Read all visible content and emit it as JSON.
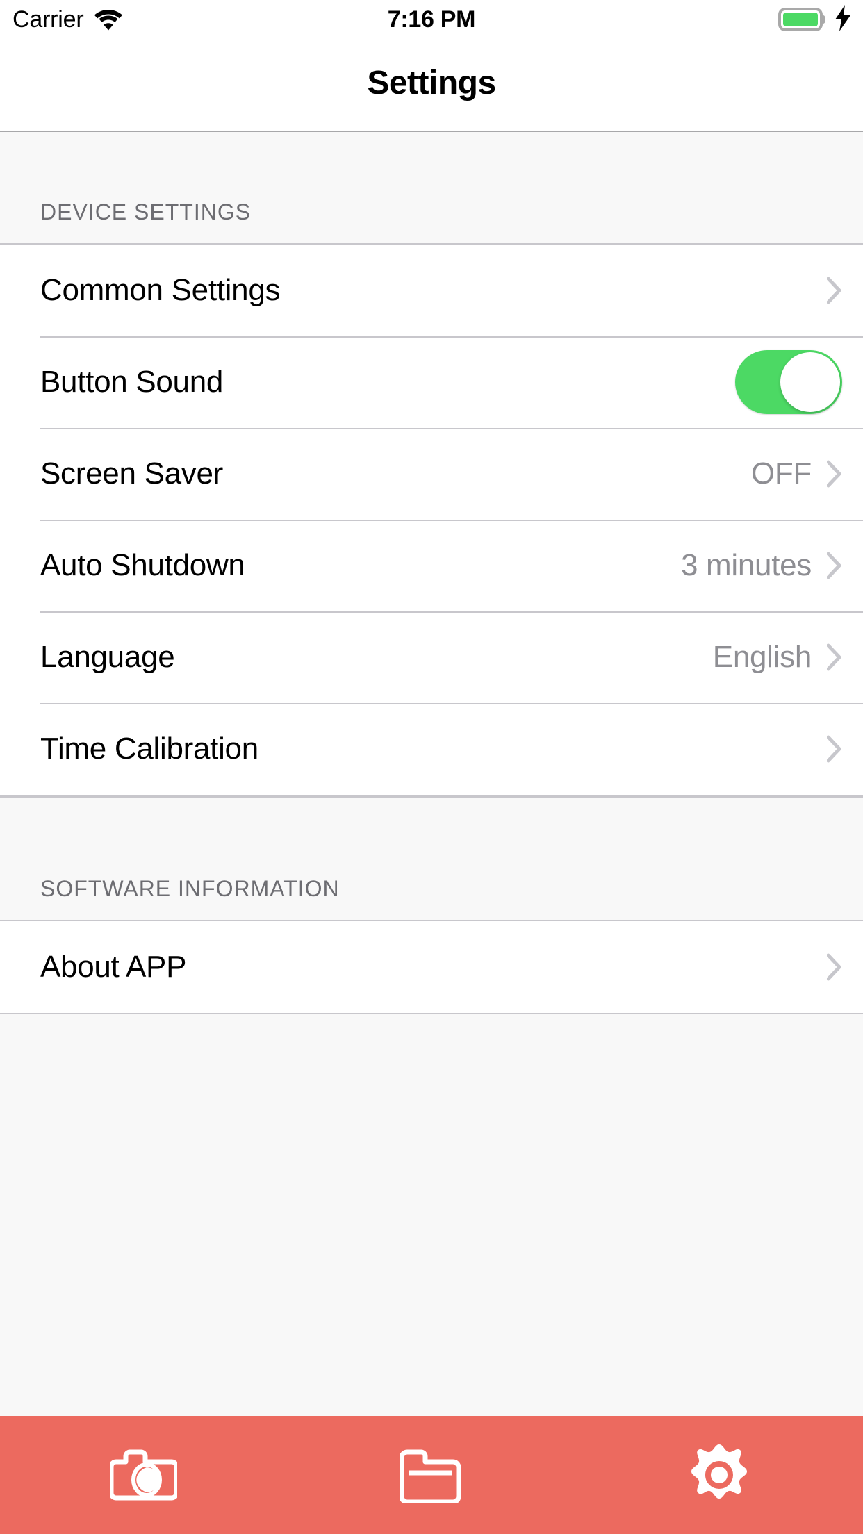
{
  "status_bar": {
    "carrier": "Carrier",
    "time": "7:16 PM",
    "wifi_icon": "wifi-icon",
    "battery_icon": "battery-full-icon",
    "charging_icon": "lightning-bolt-icon",
    "battery_color": "#4cd964"
  },
  "nav_bar": {
    "title": "Settings"
  },
  "sections": [
    {
      "header": "DEVICE SETTINGS",
      "rows": [
        {
          "label": "Common Settings",
          "value": "",
          "accessory": "chevron"
        },
        {
          "label": "Button Sound",
          "value": "",
          "accessory": "switch",
          "switch_on": true
        },
        {
          "label": "Screen Saver",
          "value": "OFF",
          "accessory": "chevron"
        },
        {
          "label": "Auto Shutdown",
          "value": "3 minutes",
          "accessory": "chevron"
        },
        {
          "label": "Language",
          "value": "English",
          "accessory": "chevron"
        },
        {
          "label": "Time Calibration",
          "value": "",
          "accessory": "chevron"
        }
      ]
    },
    {
      "header": "SOFTWARE INFORMATION",
      "rows": [
        {
          "label": "About APP",
          "value": "",
          "accessory": "chevron"
        }
      ]
    }
  ],
  "tab_bar": {
    "background_color": "#ec6a5f",
    "items": [
      {
        "icon": "camera-icon",
        "active": false
      },
      {
        "icon": "folder-icon",
        "active": false
      },
      {
        "icon": "gear-icon",
        "active": true
      }
    ]
  },
  "colors": {
    "accent": "#ec6a5f",
    "switch_on": "#4cd964",
    "value_text": "#8e8e93",
    "header_text": "#6d6d72",
    "separator": "#c8c7cc",
    "table_background": "#f8f8f8",
    "cell_background": "#ffffff"
  }
}
